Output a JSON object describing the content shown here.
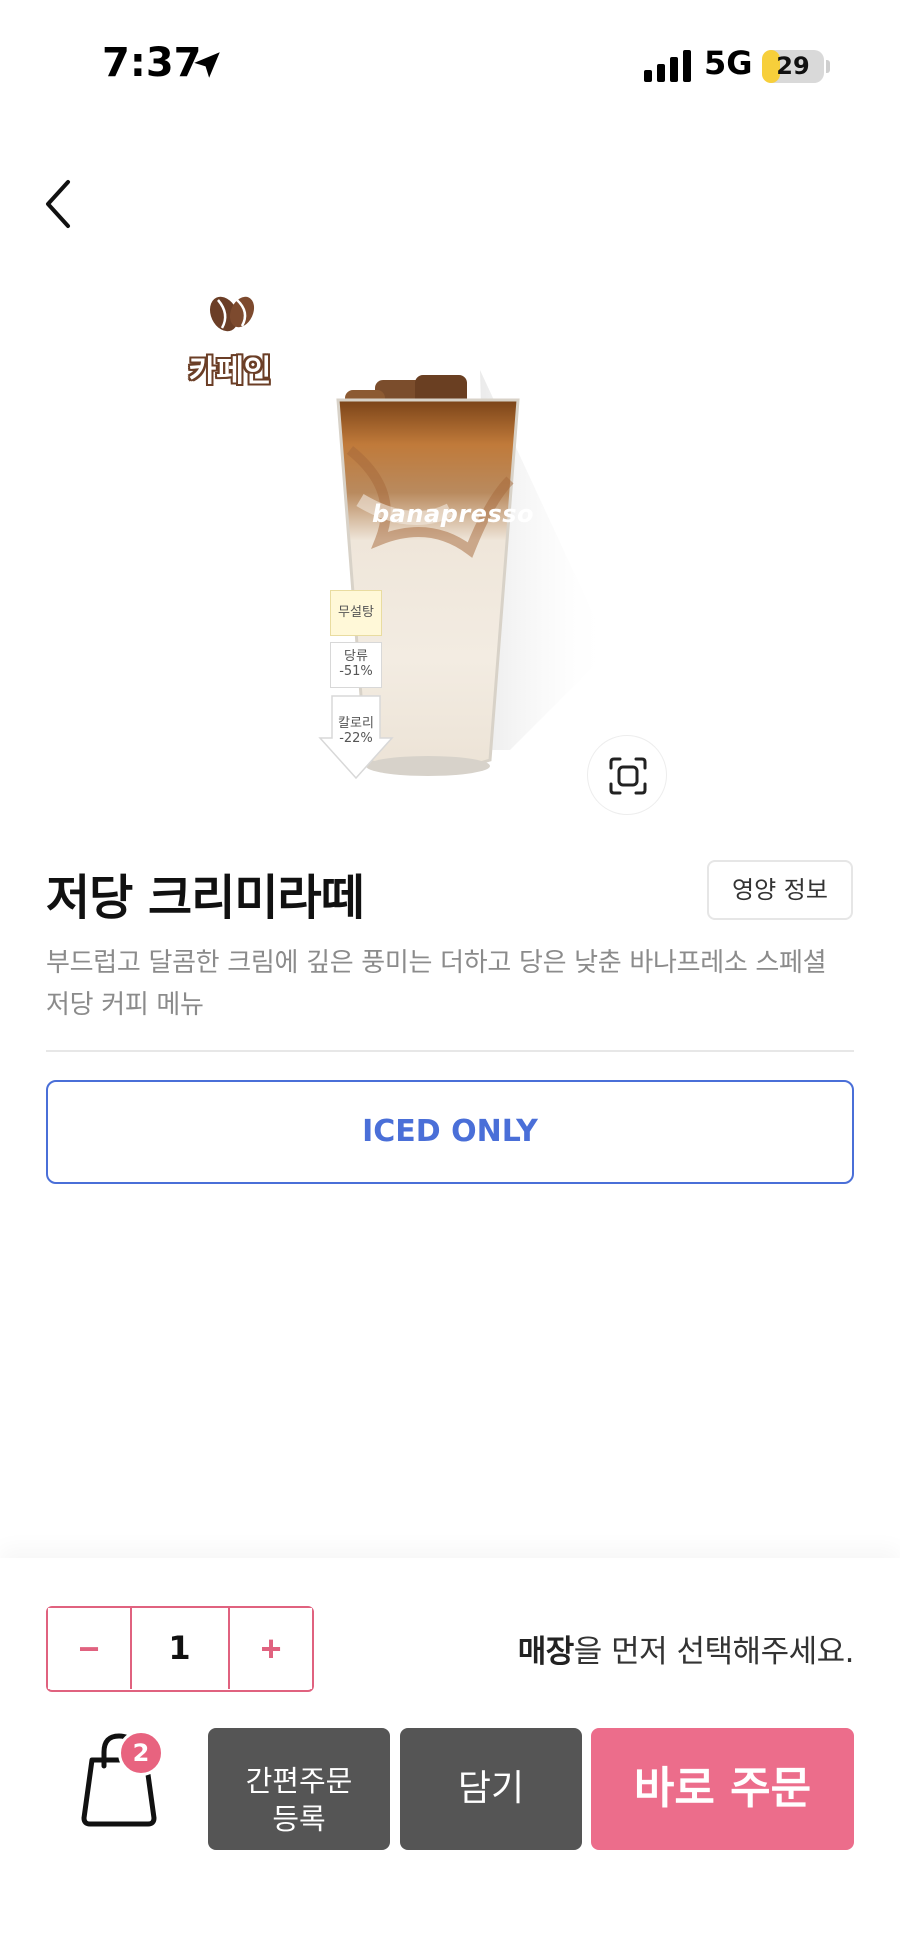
{
  "status_bar": {
    "time": "7:37",
    "network": "5G",
    "battery": "29",
    "battery_level": 0.29
  },
  "product": {
    "caffeine_label": "카페인",
    "brand_print": "banapresso",
    "tags": {
      "sugar_free": "무설탕",
      "sugar": [
        "당류",
        "-51%"
      ],
      "calorie": [
        "칼로리",
        "-22%"
      ]
    },
    "title": "저당 크리미라떼",
    "description": "부드럽고 달콤한 크림에 깊은 풍미는 더하고 당은 낮춘 바나프레소 스페셜 저당 커피 메뉴",
    "nutrition_button": "영양 정보",
    "temperature_option": "ICED ONLY"
  },
  "order": {
    "quantity": "1",
    "minus": "−",
    "plus": "+",
    "store_notice_bold": "매장",
    "store_notice_rest": "을 먼저 선택해주세요.",
    "cart_count": "2",
    "quick_order_line1": "간편주문",
    "quick_order_line2": "등록",
    "add_to_cart": "담기",
    "order_now": "바로 주문"
  },
  "colors": {
    "accent_pink": "#ec6d8b",
    "option_blue": "#4a6fd8",
    "dark_button": "#555555"
  }
}
